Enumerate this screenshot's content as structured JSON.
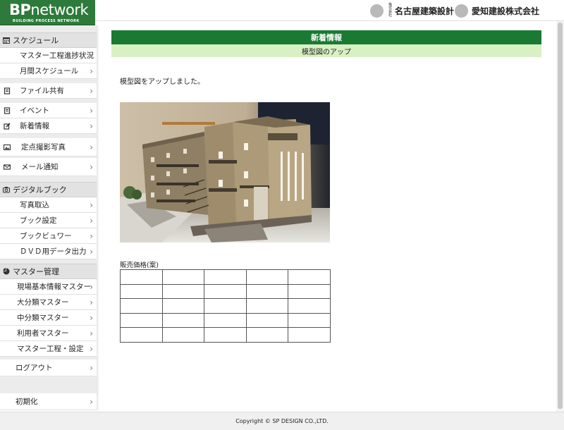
{
  "logo": {
    "main_bp": "BP",
    "main_net": "network",
    "sub": "BUILDING PROCESS NETWORK"
  },
  "header": {
    "companies": [
      {
        "prefix": "株式会社",
        "name": "名古屋建築設計"
      },
      {
        "prefix": "",
        "name": "愛知建設株式会社"
      }
    ]
  },
  "sidebar": {
    "schedule": {
      "label": "スケジュール",
      "icon": "calendar-icon",
      "items": [
        "マスター工程進捗状況",
        "月間スケジュール"
      ]
    },
    "file_share": "ファイル共有",
    "event": "イベント",
    "news": "新着情報",
    "photo": "定点撮影写真",
    "mail": "メール通知",
    "digital_book": {
      "label": "デジタルブック",
      "icon": "camera-icon",
      "items": [
        "写真取込",
        "ブック設定",
        "ブックビュワー",
        "ＤＶＤ用データ出力"
      ]
    },
    "master": {
      "label": "マスター管理",
      "icon": "pie-chart-icon",
      "items": [
        "現場基本情報マスター",
        "大分類マスター",
        "中分類マスター",
        "利用者マスター",
        "マスター工程・設定"
      ]
    },
    "logout": "ログアウト",
    "reset": "初期化"
  },
  "main": {
    "title": "新着情報",
    "subtitle": "模型図のアップ",
    "body": "模型図をアップしました。",
    "price_label": "販売価格(案)",
    "price_table": {
      "rows": 5,
      "cols": 5
    }
  },
  "footer": {
    "copyright": "Copyright © SP DESIGN CO.,LTD."
  },
  "colors": {
    "primary_green": "#1a7a34",
    "light_green": "#d9f0c4",
    "logo_green": "#2d7a3b"
  }
}
